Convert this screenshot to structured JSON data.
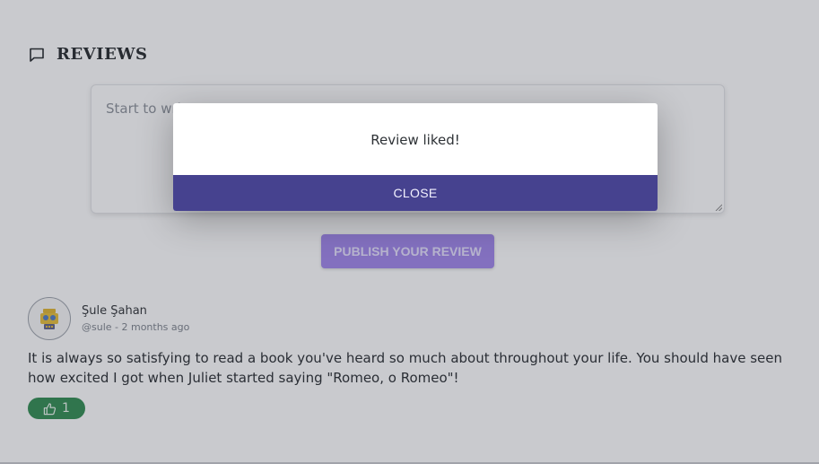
{
  "section": {
    "title": "REVIEWS",
    "icon": "speech-bubble-icon"
  },
  "composer": {
    "placeholder": "Start to wri"
  },
  "publish_button": {
    "label": "PUBLISH YOUR REVIEW"
  },
  "review": {
    "author_name": "Şule Şahan",
    "author_meta": "@sule - 2 months ago",
    "text": "It is always so satisfying to read a book you've heard so much about throughout your life. You should have seen how excited I got when Juliet started saying \"Romeo, o Romeo\"!",
    "likes": "1",
    "like_icon": "thumbs-up-icon",
    "avatar_icon": "robot-avatar-icon"
  },
  "modal": {
    "message": "Review liked!",
    "close_label": "CLOSE"
  },
  "colors": {
    "publish_button": "#9e83ea",
    "like_button": "#2c8a4d",
    "modal_close": "#46428f",
    "overlay": "rgba(60,66,80,0.28)"
  }
}
